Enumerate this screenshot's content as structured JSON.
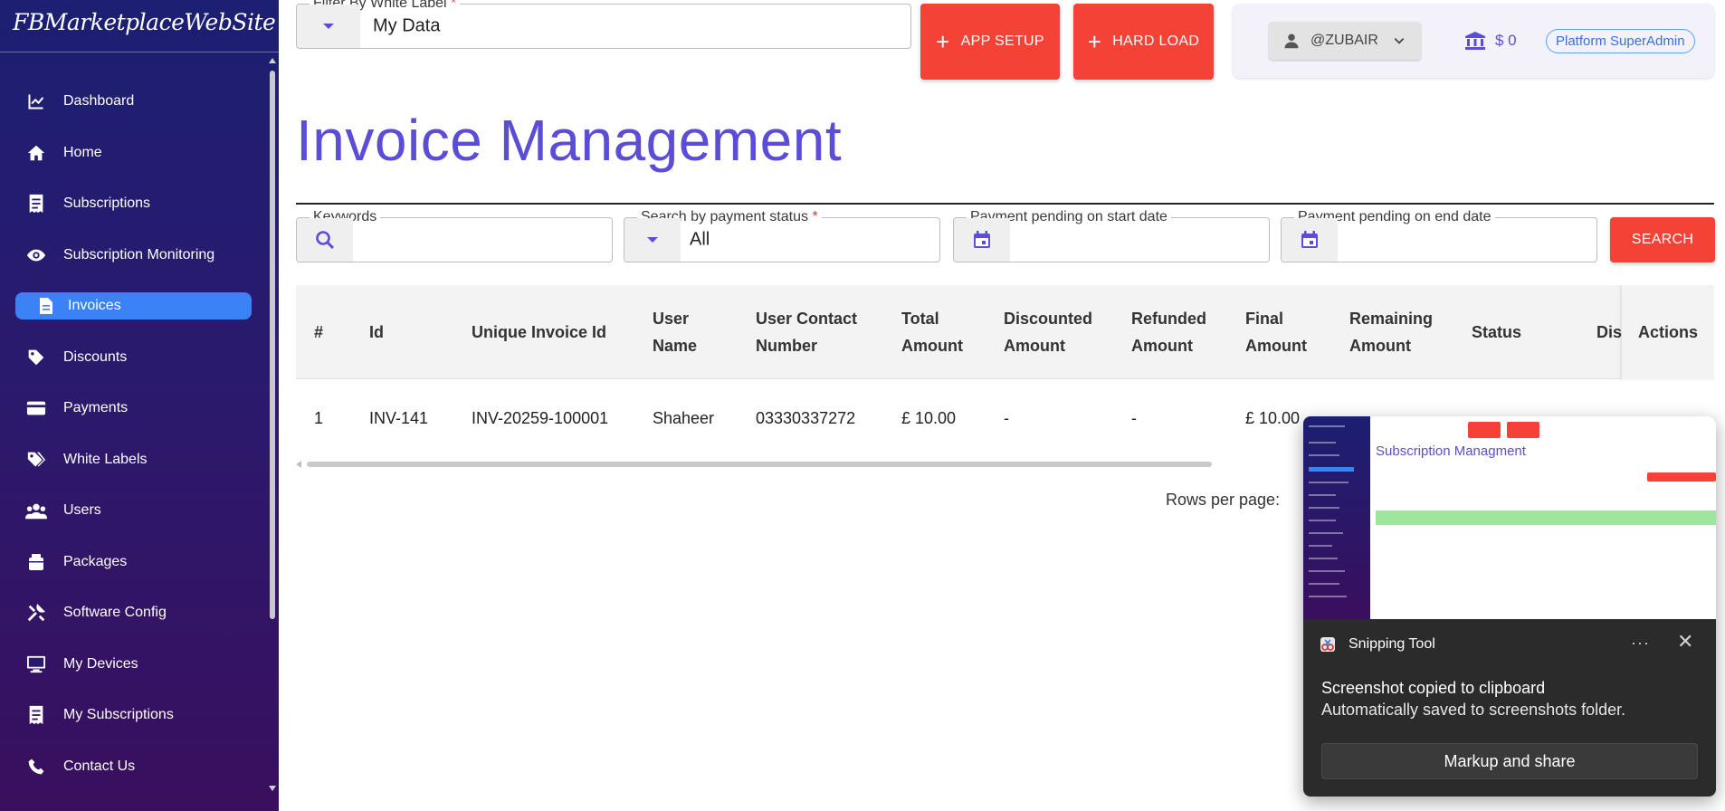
{
  "app": {
    "brand": "FBMarketplaceWebSite"
  },
  "sidebar": {
    "items": [
      {
        "label": "Dashboard",
        "icon": "chart-line-icon"
      },
      {
        "label": "Home",
        "icon": "home-icon"
      },
      {
        "label": "Subscriptions",
        "icon": "receipt-icon"
      },
      {
        "label": "Subscription Monitoring",
        "icon": "eye-icon"
      },
      {
        "label": "Invoices",
        "icon": "document-icon",
        "active": true
      },
      {
        "label": "Discounts",
        "icon": "tag-icon"
      },
      {
        "label": "Payments",
        "icon": "credit-card-icon"
      },
      {
        "label": "White Labels",
        "icon": "tags-icon"
      },
      {
        "label": "Users",
        "icon": "users-icon"
      },
      {
        "label": "Packages",
        "icon": "package-icon"
      },
      {
        "label": "Software Config",
        "icon": "tools-icon"
      },
      {
        "label": "My Devices",
        "icon": "monitor-icon"
      },
      {
        "label": "My Subscriptions",
        "icon": "receipt-icon"
      },
      {
        "label": "Contact Us",
        "icon": "phone-icon"
      }
    ]
  },
  "header": {
    "filter_label": "Filter By White Label",
    "filter_required": "*",
    "filter_value": "My Data",
    "app_setup_label": "APP SETUP",
    "hard_load_label": "HARD LOAD",
    "username": "@ZUBAIR",
    "balance": "$ 0",
    "role": "Platform SuperAdmin"
  },
  "page": {
    "title": "Invoice Management"
  },
  "filters": {
    "keywords_label": "Keywords",
    "status_label": "Search by payment status",
    "status_required": "*",
    "status_value": "All",
    "start_label": "Payment pending on start date",
    "end_label": "Payment pending on end date",
    "search_label": "SEARCH"
  },
  "table": {
    "columns": [
      "#",
      "Id",
      "Unique Invoice Id",
      "User Name",
      "User Contact Number",
      "Total Amount",
      "Discounted Amount",
      "Refunded Amount",
      "Final Amount",
      "Remaining Amount",
      "Status",
      "Disc",
      "Actions"
    ],
    "rows": [
      [
        "1",
        "INV-141",
        "INV-20259-100001",
        "Shaheer",
        "03330337272",
        "£ 10.00",
        "-",
        "-",
        "£ 10.00"
      ]
    ],
    "rows_per_page_label": "Rows per page:"
  },
  "toast": {
    "app_name": "Snipping Tool",
    "message": "Screenshot copied to clipboard",
    "sub_message": "Automatically saved to screenshots folder.",
    "action_label": "Markup and share",
    "more": "···",
    "close": "✕",
    "thumbnail_title": "Subscription Managment"
  },
  "colors": {
    "accent": "#5b4dd6",
    "red": "#f44336",
    "active_nav": "#3b82f6"
  }
}
